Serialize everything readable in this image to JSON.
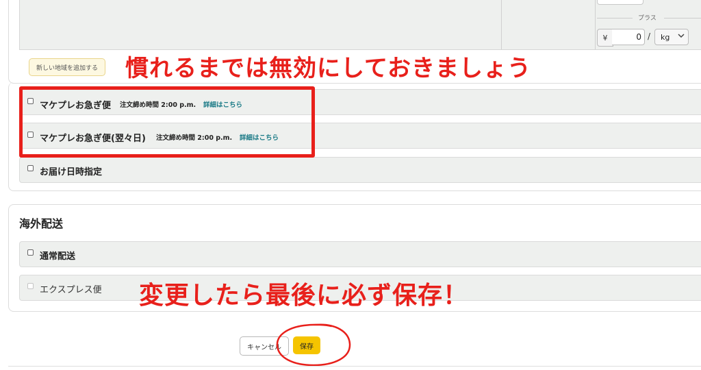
{
  "top_table": {
    "plus_label": "プラス",
    "currency_symbol": "¥",
    "amount_value": "0",
    "per_separator": "/",
    "unit_value": "kg"
  },
  "add_region_button": "新しい地域を追加する",
  "annotations": {
    "disable_note": "慣れるまでは無効にしておきましょう",
    "save_note": "変更したら最後に必ず保存！"
  },
  "domestic_options": [
    {
      "label": "マケプレお急ぎ便",
      "note": "注文締め時間 2:00 p.m.",
      "link": "詳細はこちら",
      "checked": false
    },
    {
      "label": "マケプレお急ぎ便(翌々日)",
      "note": "注文締め時間 2:00 p.m.",
      "link": "詳細はこちら",
      "checked": false
    },
    {
      "label": "お届け日時指定",
      "checked": false
    }
  ],
  "overseas": {
    "title": "海外配送",
    "options": [
      {
        "label": "通常配送",
        "checked": false,
        "disabled": false
      },
      {
        "label": "エクスプレス便",
        "checked": false,
        "disabled": true
      }
    ]
  },
  "footer": {
    "cancel_label": "キャンセル",
    "save_label": "保存"
  },
  "colors": {
    "annotation_red": "#e8201b",
    "save_yellow": "#f5c400",
    "link_teal": "#1a7a86",
    "row_grey": "#eef0ee"
  }
}
